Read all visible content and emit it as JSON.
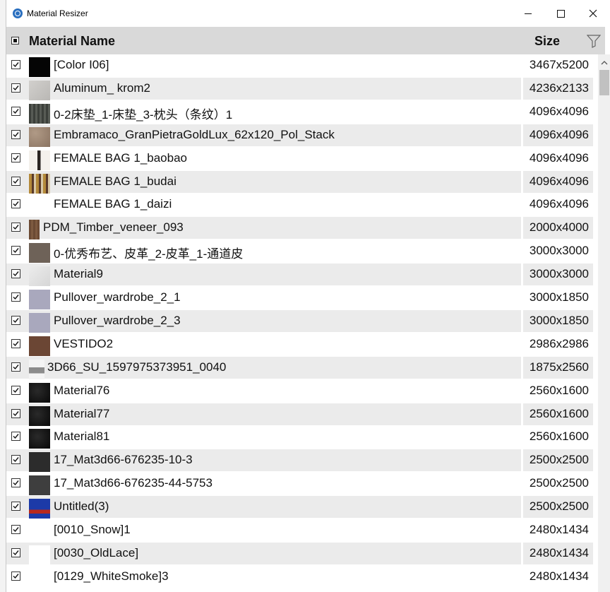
{
  "window": {
    "title": "Material Resizer"
  },
  "header": {
    "name_label": "Material Name",
    "size_label": "Size"
  },
  "colors": {
    "header_bg": "#d9d9d9",
    "alt_row_bg": "#ebebeb",
    "accent": "#2a6fbf"
  },
  "rows": [
    {
      "name": "[Color I06]",
      "size": "3467x5200",
      "checked": true,
      "swatch": "black"
    },
    {
      "name": "Aluminum_ krom2",
      "size": "4236x2133",
      "checked": true,
      "swatch": "light-gray"
    },
    {
      "name": "0-2床垫_1-床垫_3-枕头（条纹）1",
      "size": "4096x4096",
      "checked": true,
      "swatch": "dark-stripes"
    },
    {
      "name": "Embramaco_GranPietraGoldLux_62x120_Pol_Stack",
      "size": "4096x4096",
      "checked": true,
      "swatch": "stone"
    },
    {
      "name": "FEMALE BAG 1_baobao",
      "size": "4096x4096",
      "checked": true,
      "swatch": "bag-white"
    },
    {
      "name": "FEMALE BAG 1_budai",
      "size": "4096x4096",
      "checked": true,
      "swatch": "bag-gold"
    },
    {
      "name": "FEMALE BAG 1_daizi",
      "size": "4096x4096",
      "checked": true,
      "swatch": "blank"
    },
    {
      "name": "PDM_Timber_veneer_093",
      "size": "2000x4000",
      "checked": true,
      "swatch": "wood"
    },
    {
      "name": "0-优秀布艺、皮革_2-皮革_1-通道皮",
      "size": "3000x3000",
      "checked": true,
      "swatch": "leather"
    },
    {
      "name": "Material9",
      "size": "3000x3000",
      "checked": true,
      "swatch": "marble"
    },
    {
      "name": "Pullover_wardrobe_2_1",
      "size": "3000x1850",
      "checked": true,
      "swatch": "lilac"
    },
    {
      "name": "Pullover_wardrobe_2_3",
      "size": "3000x1850",
      "checked": true,
      "swatch": "lilac"
    },
    {
      "name": "VESTIDO2",
      "size": "2986x2986",
      "checked": true,
      "swatch": "brown"
    },
    {
      "name": "3D66_SU_1597975373951_0040",
      "size": "1875x2560",
      "checked": true,
      "swatch": "figure"
    },
    {
      "name": "Material76",
      "size": "2560x1600",
      "checked": true,
      "swatch": "black-texture"
    },
    {
      "name": "Material77",
      "size": "2560x1600",
      "checked": true,
      "swatch": "black-texture"
    },
    {
      "name": "Material81",
      "size": "2560x1600",
      "checked": true,
      "swatch": "black-texture"
    },
    {
      "name": "17_Mat3d66-676235-10-3",
      "size": "2500x2500",
      "checked": true,
      "swatch": "charcoal"
    },
    {
      "name": "17_Mat3d66-676235-44-5753",
      "size": "2500x2500",
      "checked": true,
      "swatch": "charcoal-light"
    },
    {
      "name": "Untitled(3)",
      "size": "2500x2500",
      "checked": true,
      "swatch": "blue-red"
    },
    {
      "name": "[0010_Snow]1",
      "size": "2480x1434",
      "checked": true,
      "swatch": "blank"
    },
    {
      "name": "[0030_OldLace]",
      "size": "2480x1434",
      "checked": true,
      "swatch": "white"
    },
    {
      "name": "[0129_WhiteSmoke]3",
      "size": "2480x1434",
      "checked": true,
      "swatch": "blank"
    }
  ]
}
